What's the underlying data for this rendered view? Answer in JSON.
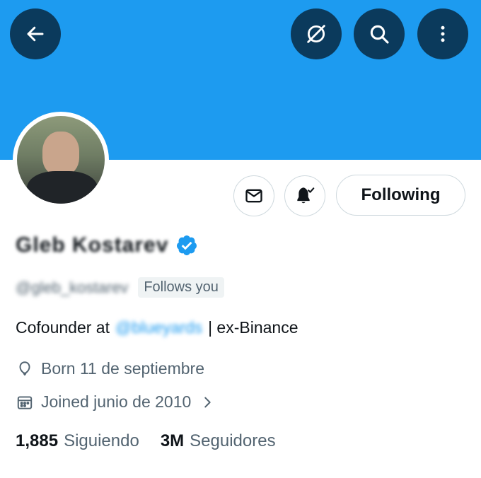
{
  "profile": {
    "display_name": "Gleb Kostarev",
    "handle": "@gleb_kostarev",
    "follows_you": "Follows you",
    "bio_prefix": "Cofounder at",
    "bio_mention": "@blueyards",
    "bio_suffix": "| ex-Binance",
    "born": "Born 11 de septiembre",
    "joined": "Joined junio de 2010",
    "following_count": "1,885",
    "following_label": "Siguiendo",
    "followers_count": "3M",
    "followers_label": "Seguidores"
  },
  "actions": {
    "following_label": "Following"
  },
  "icons": {
    "back": "arrow-left-icon",
    "grok": "grok-icon",
    "search": "search-icon",
    "more": "more-vertical-icon",
    "dm": "envelope-icon",
    "notifications": "bell-check-icon",
    "verified": "verified-badge-icon",
    "born": "balloon-icon",
    "joined": "calendar-icon",
    "chevron": "chevron-right-icon"
  },
  "colors": {
    "banner": "#1d9bf0",
    "accent": "#1d9bf0",
    "header_button": "#0b3a5c",
    "secondary_text": "#536471"
  }
}
